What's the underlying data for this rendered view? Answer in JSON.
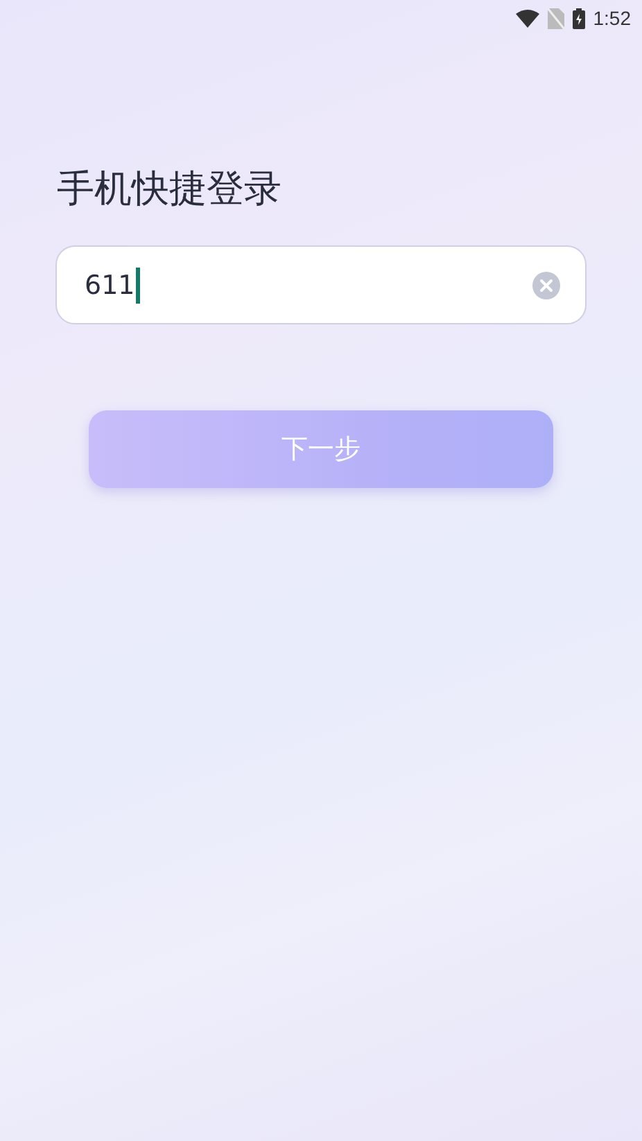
{
  "status_bar": {
    "time": "1:52"
  },
  "title": "手机快捷登录",
  "phone_field": {
    "value": "611"
  },
  "next_button": {
    "label": "下一步"
  }
}
